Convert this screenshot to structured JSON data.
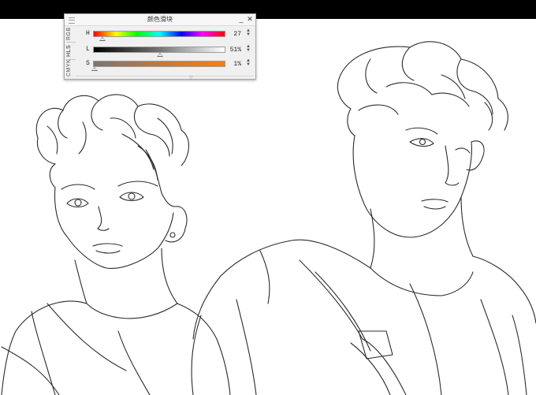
{
  "panel": {
    "title": "颜色滑块",
    "minimize_icon": "minimize-icon",
    "close_icon": "close-icon"
  },
  "modes": [
    {
      "label": "RGB",
      "active": false
    },
    {
      "label": "HLS",
      "active": true
    },
    {
      "label": "CMYK",
      "active": false
    }
  ],
  "sliders": [
    {
      "letter": "H",
      "value": "27",
      "position": 0.075
    },
    {
      "letter": "L",
      "value": "51%",
      "position": 0.51
    },
    {
      "letter": "S",
      "value": "1%",
      "position": 0.01
    }
  ],
  "colors": {
    "accent_selected": "#ff7d08",
    "topbar": "#000000",
    "panel_bg": "#f0f0f0"
  },
  "canvas": {
    "content": "line-art sketch of two young men"
  }
}
